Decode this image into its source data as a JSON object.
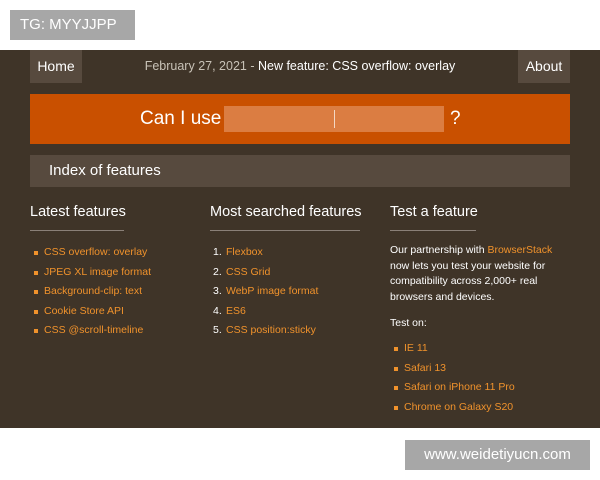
{
  "tag": "TG: MYYJJPP",
  "watermark": "www.weidetiyucn.com",
  "nav": {
    "home": "Home",
    "about": "About",
    "news_date": "February 27, 2021",
    "news_separator": " - ",
    "news_title": "New feature: CSS overflow: overlay"
  },
  "search": {
    "prefix": "Can I use",
    "value": "",
    "suffix": "?"
  },
  "index_label": "Index of features",
  "latest": {
    "title": "Latest features",
    "items": [
      "CSS overflow: overlay",
      "JPEG XL image format",
      "Background-clip: text",
      "Cookie Store API",
      "CSS @scroll-timeline"
    ]
  },
  "searched": {
    "title": "Most searched features",
    "items": [
      {
        "num": "1.",
        "label": "Flexbox"
      },
      {
        "num": "2.",
        "label": "CSS Grid"
      },
      {
        "num": "3.",
        "label": "WebP image format"
      },
      {
        "num": "4.",
        "label": "ES6"
      },
      {
        "num": "5.",
        "label": "CSS position:sticky"
      }
    ]
  },
  "test": {
    "title": "Test a feature",
    "text_before": "Our partnership with ",
    "partner": "BrowserStack",
    "text_after": " now lets you test your website for compatibility across 2,000+ real browsers and devices.",
    "test_on": "Test on:",
    "items": [
      "IE 11",
      "Safari 13",
      "Safari on iPhone 11 Pro",
      "Chrome on Galaxy S20"
    ]
  },
  "colors": {
    "background": "#3f3428",
    "panel": "#574a3e",
    "accent": "#c95000",
    "link": "#f0922c"
  }
}
